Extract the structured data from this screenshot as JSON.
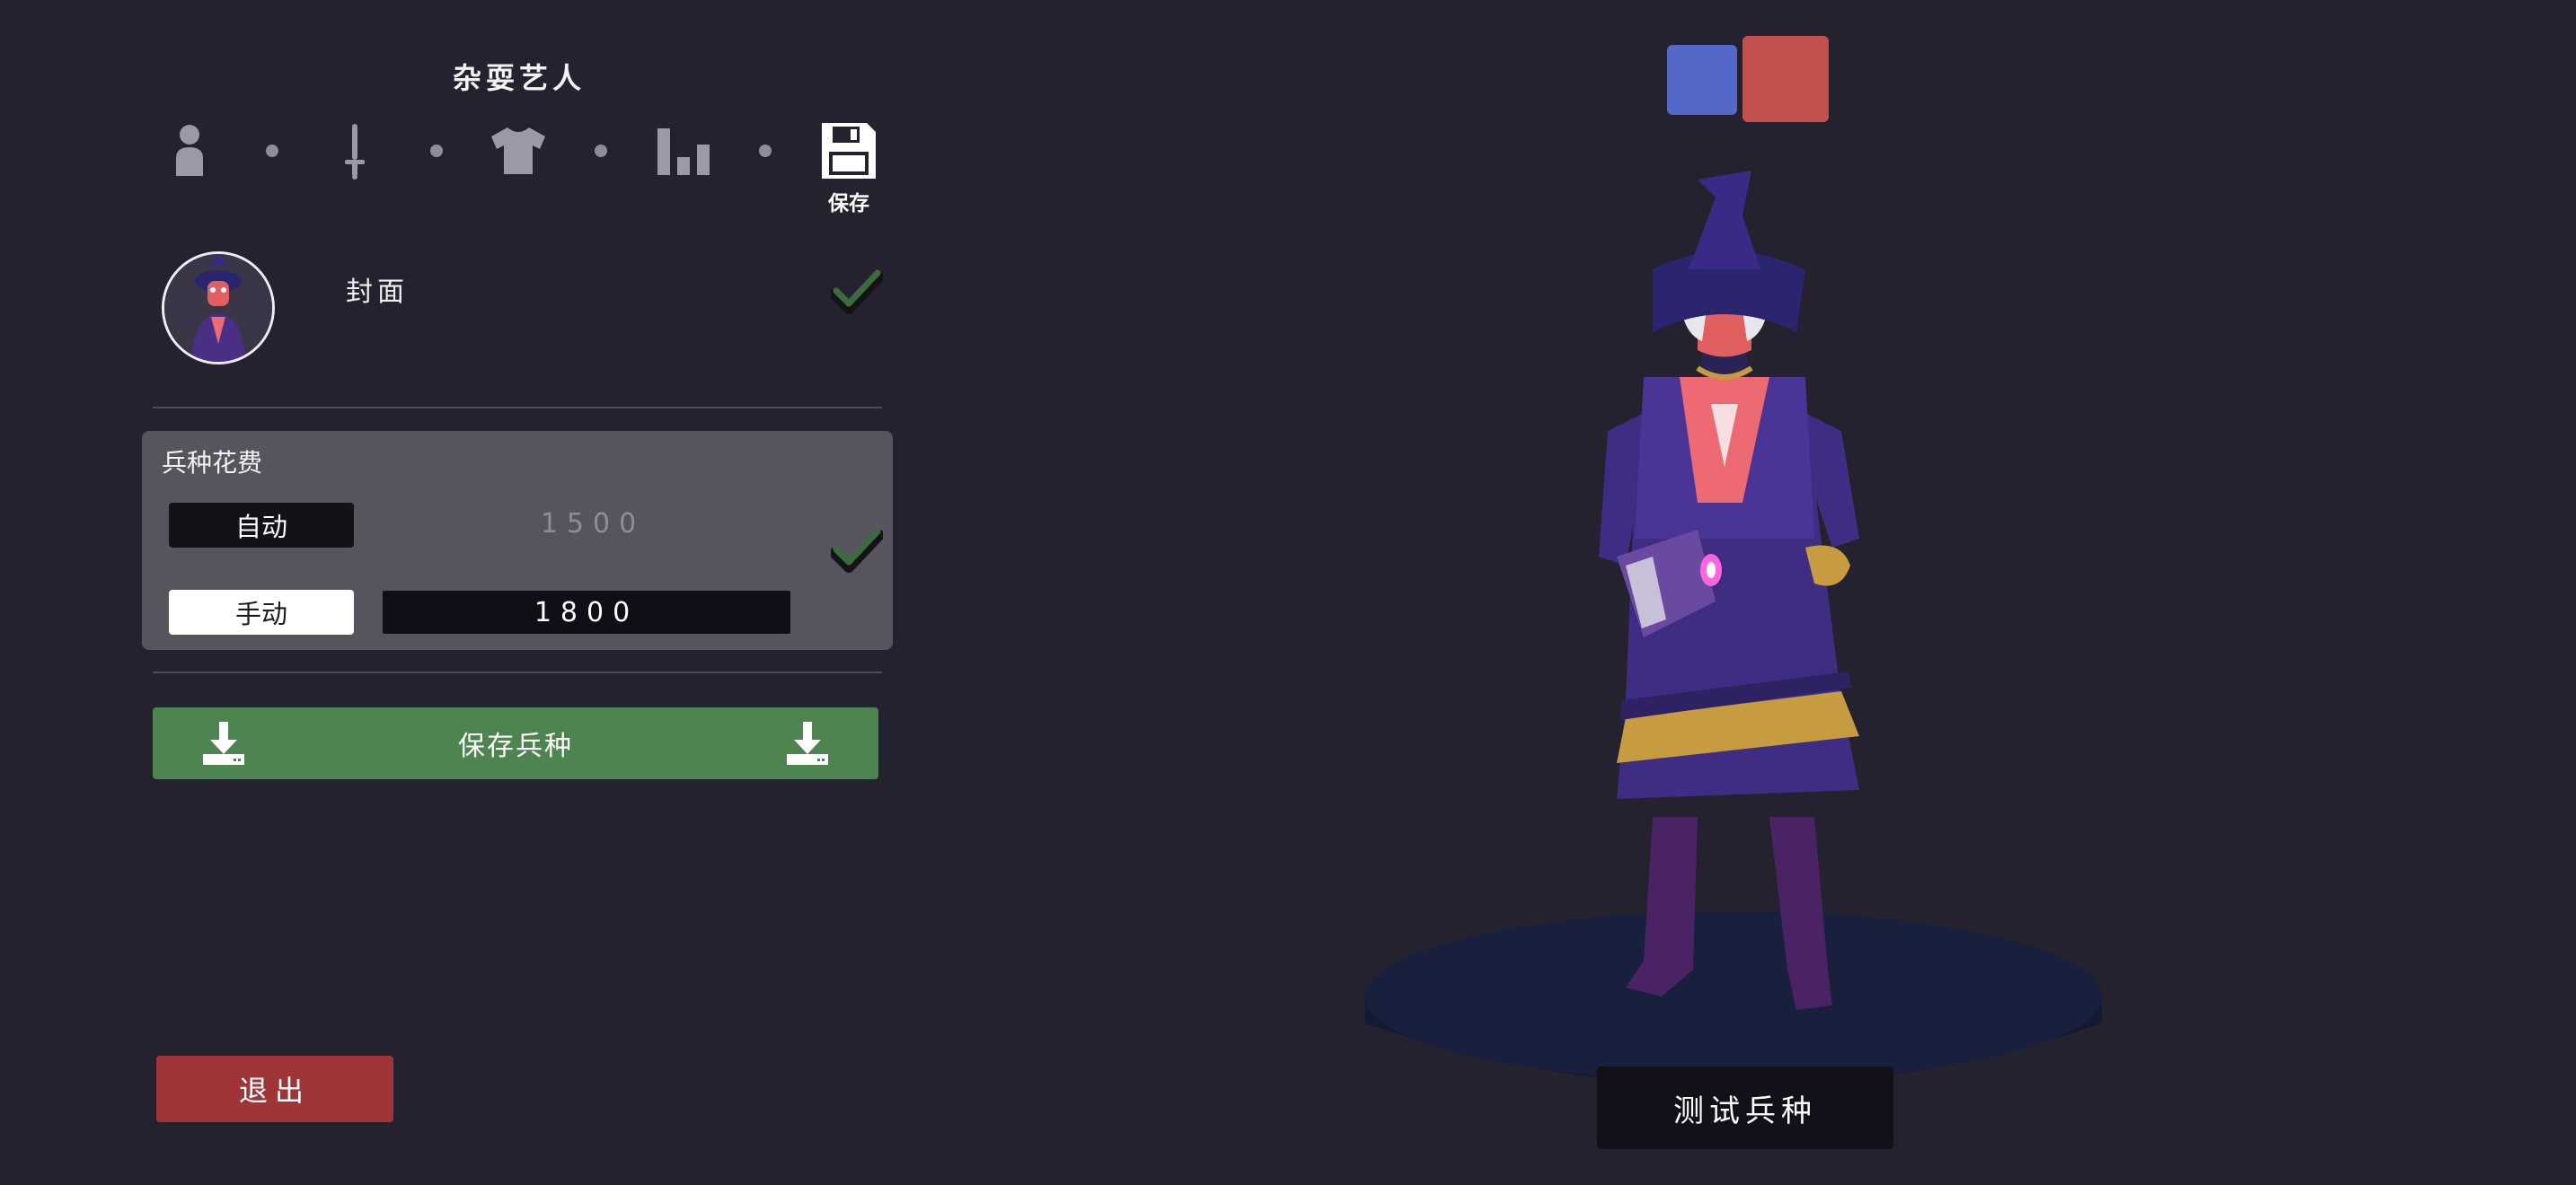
{
  "title": "杂耍艺人",
  "steps": [
    {
      "name": "unit-base",
      "icon": "person-icon"
    },
    {
      "name": "weapons",
      "icon": "sword-icon"
    },
    {
      "name": "clothing",
      "icon": "shirt-icon"
    },
    {
      "name": "stats",
      "icon": "bar-chart-icon"
    },
    {
      "name": "save",
      "icon": "floppy-disk-icon",
      "label": "保存"
    }
  ],
  "cover": {
    "label": "封面",
    "checked": true
  },
  "cost": {
    "title": "兵种花费",
    "auto": {
      "label": "自动",
      "value": "1500"
    },
    "manual": {
      "label": "手动",
      "value": "1800"
    },
    "selected": "manual",
    "checked": true
  },
  "save_unit": {
    "label": "保存兵种",
    "icon": "download-icon"
  },
  "exit": {
    "label": "退出"
  },
  "teams": [
    {
      "name": "blue",
      "color": "#5368c9"
    },
    {
      "name": "red",
      "color": "#c2504d",
      "selected": true
    }
  ],
  "test_unit": {
    "label": "测试兵种"
  },
  "colors": {
    "background": "#23222e",
    "panel": "#56555d",
    "save_green": "#4e8450",
    "exit_red": "#a03538",
    "check_green": "#3d6b3e"
  }
}
